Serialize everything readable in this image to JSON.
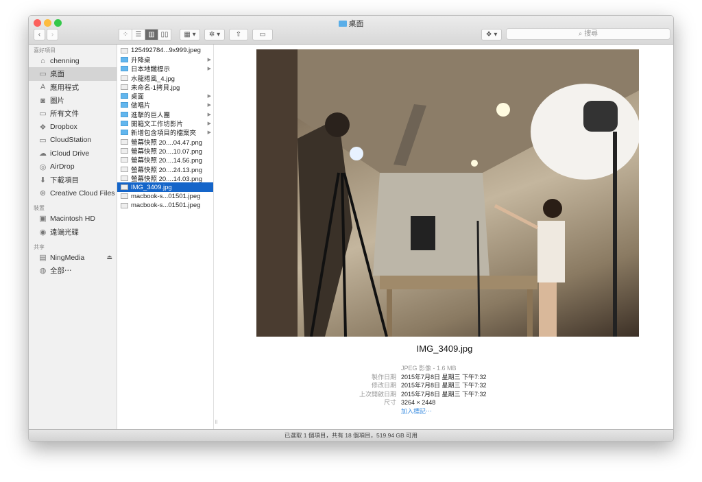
{
  "window": {
    "title": "桌面"
  },
  "toolbar": {
    "search_placeholder": "搜尋",
    "back": "‹",
    "forward": "›",
    "views": [
      "icon",
      "list",
      "column",
      "coverflow"
    ],
    "active_view": "column"
  },
  "sidebar": {
    "sections": [
      {
        "header": "喜好項目",
        "items": [
          {
            "label": "chenning",
            "icon": "home-icon"
          },
          {
            "label": "桌面",
            "icon": "desktop-icon",
            "selected": true
          },
          {
            "label": "應用程式",
            "icon": "applications-icon"
          },
          {
            "label": "圖片",
            "icon": "camera-icon"
          },
          {
            "label": "所有文件",
            "icon": "folder-icon"
          },
          {
            "label": "Dropbox",
            "icon": "dropbox-icon"
          },
          {
            "label": "CloudStation",
            "icon": "folder-icon"
          },
          {
            "label": "iCloud Drive",
            "icon": "cloud-icon"
          },
          {
            "label": "AirDrop",
            "icon": "airdrop-icon"
          },
          {
            "label": "下載項目",
            "icon": "download-icon"
          },
          {
            "label": "Creative Cloud Files",
            "icon": "creative-cloud-icon"
          }
        ]
      },
      {
        "header": "裝置",
        "items": [
          {
            "label": "Macintosh HD",
            "icon": "disk-icon"
          },
          {
            "label": "遠端光碟",
            "icon": "optical-disc-icon"
          }
        ]
      },
      {
        "header": "共享",
        "items": [
          {
            "label": "NingMedia",
            "icon": "server-icon",
            "eject": "⏏"
          },
          {
            "label": "全部⋯",
            "icon": "network-icon"
          }
        ]
      }
    ]
  },
  "files": [
    {
      "name": "125492784...9x999.jpeg",
      "type": "file"
    },
    {
      "name": "升降桌",
      "type": "folder"
    },
    {
      "name": "日本地鐵標示",
      "type": "folder"
    },
    {
      "name": "水龍捲風_4.jpg",
      "type": "file"
    },
    {
      "name": "未命名-1拷貝.jpg",
      "type": "file"
    },
    {
      "name": "桌面",
      "type": "folder"
    },
    {
      "name": "做唱片",
      "type": "folder"
    },
    {
      "name": "進擊的巨人團",
      "type": "folder"
    },
    {
      "name": "開箱文工作坊影片",
      "type": "folder"
    },
    {
      "name": "新增包含項目的檔案夾",
      "type": "folder"
    },
    {
      "name": "螢幕快照 20....04.47.png",
      "type": "file"
    },
    {
      "name": "螢幕快照 20....10.07.png",
      "type": "file"
    },
    {
      "name": "螢幕快照 20....14.56.png",
      "type": "file"
    },
    {
      "name": "螢幕快照 20....24.13.png",
      "type": "file"
    },
    {
      "name": "螢幕快照 20....14.03.png",
      "type": "file"
    },
    {
      "name": "IMG_3409.jpg",
      "type": "file",
      "selected": true
    },
    {
      "name": "macbook-s...01501.jpeg",
      "type": "file"
    },
    {
      "name": "macbook-s...01501.jpeg",
      "type": "file"
    }
  ],
  "preview": {
    "name": "IMG_3409.jpg",
    "kind": "JPEG 影像 - 1.6 MB",
    "rows": [
      {
        "k": "製作日期",
        "v": "2015年7月8日 星期三 下午7:32"
      },
      {
        "k": "修改日期",
        "v": "2015年7月8日 星期三 下午7:32"
      },
      {
        "k": "上次開啟日期",
        "v": "2015年7月8日 星期三 下午7:32"
      },
      {
        "k": "尺寸",
        "v": "3264 × 2448"
      }
    ],
    "add_tags": "加入標記⋯"
  },
  "status": "已選取 1 個項目，共有 18 個項目，519.94 GB 可用"
}
